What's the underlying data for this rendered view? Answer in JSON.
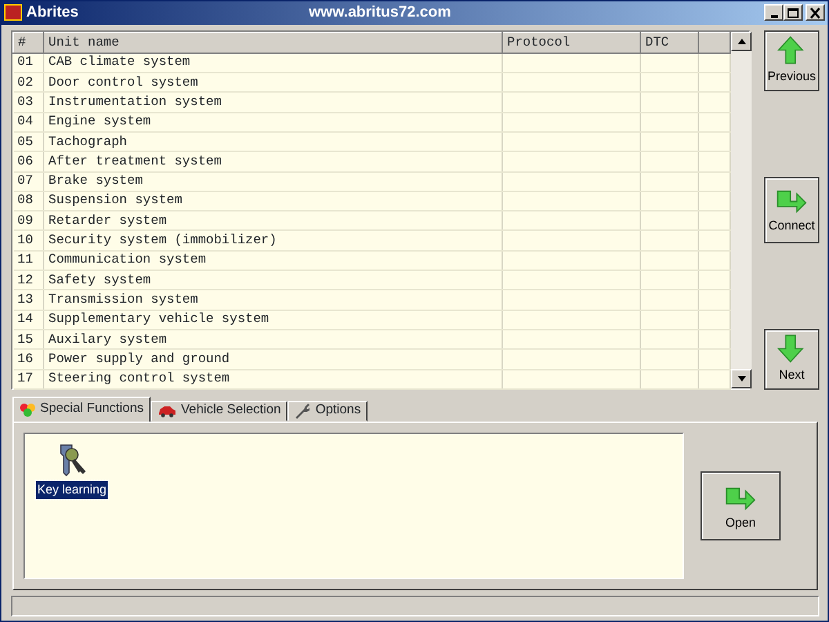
{
  "window": {
    "title": "Abrites",
    "url": "www.abritus72.com"
  },
  "table": {
    "columns": [
      "#",
      "Unit name",
      "Protocol",
      "DTC"
    ],
    "rows": [
      {
        "number": "01",
        "unit": "CAB climate system"
      },
      {
        "number": "02",
        "unit": "Door control system"
      },
      {
        "number": "03",
        "unit": "Instrumentation system"
      },
      {
        "number": "04",
        "unit": "Engine system"
      },
      {
        "number": "05",
        "unit": "Tachograph"
      },
      {
        "number": "06",
        "unit": "After treatment system"
      },
      {
        "number": "07",
        "unit": "Brake system"
      },
      {
        "number": "08",
        "unit": "Suspension system"
      },
      {
        "number": "09",
        "unit": "Retarder system"
      },
      {
        "number": "10",
        "unit": "Security system (immobilizer)"
      },
      {
        "number": "11",
        "unit": "Communication system"
      },
      {
        "number": "12",
        "unit": "Safety system"
      },
      {
        "number": "13",
        "unit": "Transmission system"
      },
      {
        "number": "14",
        "unit": "Supplementary vehicle system"
      },
      {
        "number": "15",
        "unit": "Auxilary system"
      },
      {
        "number": "16",
        "unit": "Power supply and ground"
      },
      {
        "number": "17",
        "unit": "Steering control system"
      }
    ]
  },
  "side_buttons": [
    {
      "label": "Previous",
      "kind": "up"
    },
    {
      "label": "Connect",
      "kind": "right"
    },
    {
      "label": "Next",
      "kind": "down"
    }
  ],
  "tabs": [
    {
      "label": "Special Functions",
      "kind": "functions",
      "selected": true
    },
    {
      "label": "Vehicle Selection",
      "kind": "car",
      "selected": false
    },
    {
      "label": "Options",
      "kind": "wrench",
      "selected": false
    }
  ],
  "functions": [
    {
      "label": "Key learning",
      "selected": true
    }
  ],
  "open_button": {
    "label": "Open"
  }
}
